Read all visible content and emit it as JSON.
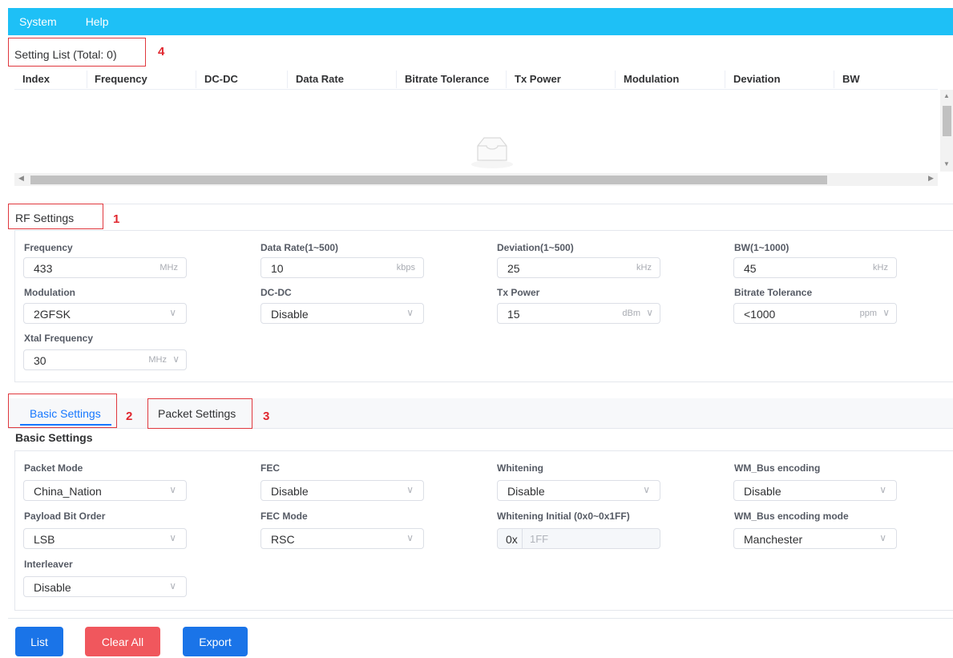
{
  "menubar": {
    "items": [
      "System",
      "Help"
    ]
  },
  "setting_list": {
    "title": "Setting List (Total: 0)",
    "columns": [
      "Index",
      "Frequency",
      "DC-DC",
      "Data Rate",
      "Bitrate Tolerance",
      "Tx Power",
      "Modulation",
      "Deviation",
      "BW"
    ],
    "rows": []
  },
  "annotations": [
    "1",
    "2",
    "3",
    "4"
  ],
  "rf_settings": {
    "title": "RF Settings",
    "frequency": {
      "label": "Frequency",
      "value": "433",
      "unit": "MHz"
    },
    "data_rate": {
      "label": "Data Rate(1~500)",
      "value": "10",
      "unit": "kbps"
    },
    "deviation": {
      "label": "Deviation(1~500)",
      "value": "25",
      "unit": "kHz"
    },
    "bw": {
      "label": "BW(1~1000)",
      "value": "45",
      "unit": "kHz"
    },
    "modulation": {
      "label": "Modulation",
      "value": "2GFSK"
    },
    "dcdc": {
      "label": "DC-DC",
      "value": "Disable"
    },
    "tx_power": {
      "label": "Tx Power",
      "value": "15",
      "unit": "dBm"
    },
    "bitrate_tolerance": {
      "label": "Bitrate Tolerance",
      "value": "<1000",
      "unit": "ppm"
    },
    "xtal_frequency": {
      "label": "Xtal Frequency",
      "value": "30",
      "unit": "MHz"
    }
  },
  "tabs": {
    "basic": "Basic Settings",
    "packet": "Packet Settings",
    "active": "basic"
  },
  "basic_settings": {
    "title": "Basic Settings",
    "packet_mode": {
      "label": "Packet Mode",
      "value": "China_Nation"
    },
    "fec": {
      "label": "FEC",
      "value": "Disable"
    },
    "whitening": {
      "label": "Whitening",
      "value": "Disable"
    },
    "wm_bus_encoding": {
      "label": "WM_Bus encoding",
      "value": "Disable"
    },
    "payload_bit_order": {
      "label": "Payload Bit Order",
      "value": "LSB"
    },
    "fec_mode": {
      "label": "FEC Mode",
      "value": "RSC"
    },
    "whitening_initial": {
      "label": "Whitening Initial (0x0~0x1FF)",
      "prefix": "0x",
      "placeholder": "1FF"
    },
    "wm_bus_encoding_mode": {
      "label": "WM_Bus encoding mode",
      "value": "Manchester"
    },
    "interleaver": {
      "label": "Interleaver",
      "value": "Disable"
    }
  },
  "buttons": {
    "list": "List",
    "clear_all": "Clear All",
    "export": "Export"
  },
  "colors": {
    "menubar": "#1ec0f6",
    "primary": "#1a74e8",
    "danger": "#f0575d",
    "annotation": "#e0383e"
  }
}
